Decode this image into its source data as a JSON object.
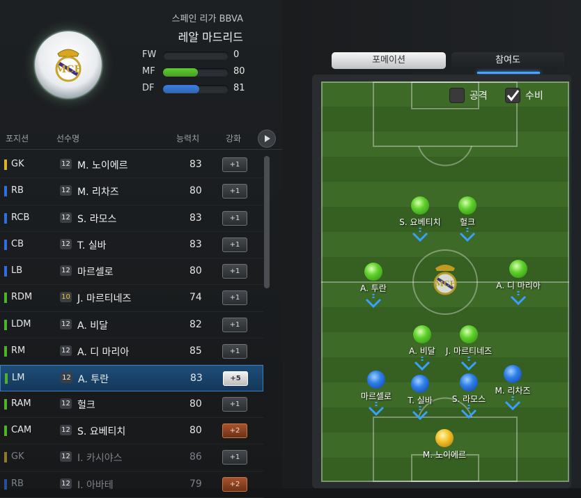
{
  "team": {
    "league": "스페인 리가 BBVA",
    "club": "레알 마드리드",
    "badge_icon": "real-madrid-crest-icon"
  },
  "stats": [
    {
      "label": "FW",
      "value": "0",
      "fill": 0,
      "color": "#2d3236"
    },
    {
      "label": "MF",
      "value": "80",
      "fill": 0.53,
      "color": "#5ccf2a"
    },
    {
      "label": "DF",
      "value": "81",
      "fill": 0.55,
      "color": "#3a7fe6"
    }
  ],
  "columns": {
    "position": "포지션",
    "name": "선수명",
    "rating": "능력치",
    "enhance": "강화"
  },
  "players": [
    {
      "pos": "GK",
      "poscolor": "#d9b42a",
      "card": "12",
      "name": "M. 노이에르",
      "ovr": "83",
      "enh": "+1",
      "style": "",
      "dim": false,
      "sel": false
    },
    {
      "pos": "RB",
      "poscolor": "#2f6fe0",
      "card": "12",
      "name": "M. 리차즈",
      "ovr": "80",
      "enh": "+1",
      "style": "",
      "dim": false,
      "sel": false
    },
    {
      "pos": "RCB",
      "poscolor": "#2f6fe0",
      "card": "12",
      "name": "S. 라모스",
      "ovr": "83",
      "enh": "+1",
      "style": "",
      "dim": false,
      "sel": false
    },
    {
      "pos": "CB",
      "poscolor": "#2f6fe0",
      "card": "12",
      "name": "T. 실바",
      "ovr": "83",
      "enh": "+1",
      "style": "",
      "dim": false,
      "sel": false
    },
    {
      "pos": "LB",
      "poscolor": "#2f6fe0",
      "card": "12",
      "name": "마르셀로",
      "ovr": "80",
      "enh": "+1",
      "style": "",
      "dim": false,
      "sel": false
    },
    {
      "pos": "RDM",
      "poscolor": "#4db32b",
      "card": "10",
      "name": "J. 마르티네즈",
      "ovr": "74",
      "enh": "+1",
      "style": "",
      "dim": false,
      "sel": false,
      "gold": true
    },
    {
      "pos": "LDM",
      "poscolor": "#4db32b",
      "card": "12",
      "name": "A. 비달",
      "ovr": "82",
      "enh": "+1",
      "style": "",
      "dim": false,
      "sel": false
    },
    {
      "pos": "RM",
      "poscolor": "#4db32b",
      "card": "12",
      "name": "A. 디 마리아",
      "ovr": "85",
      "enh": "+1",
      "style": "",
      "dim": false,
      "sel": false
    },
    {
      "pos": "LM",
      "poscolor": "#4db32b",
      "card": "12",
      "name": "A. 투란",
      "ovr": "83",
      "enh": "+5",
      "style": "white",
      "dim": false,
      "sel": true
    },
    {
      "pos": "RAM",
      "poscolor": "#4db32b",
      "card": "12",
      "name": "헐크",
      "ovr": "80",
      "enh": "+1",
      "style": "",
      "dim": false,
      "sel": false
    },
    {
      "pos": "CAM",
      "poscolor": "#4db32b",
      "card": "12",
      "name": "S. 요베티치",
      "ovr": "80",
      "enh": "+2",
      "style": "orange",
      "dim": false,
      "sel": false
    },
    {
      "pos": "GK",
      "poscolor": "#8a7a2a",
      "card": "12",
      "name": "I. 카시야스",
      "ovr": "86",
      "enh": "+1",
      "style": "",
      "dim": true,
      "sel": false
    },
    {
      "pos": "RB",
      "poscolor": "#2a4f99",
      "card": "12",
      "name": "I. 아바테",
      "ovr": "79",
      "enh": "+2",
      "style": "orange",
      "dim": true,
      "sel": false
    }
  ],
  "tabs": {
    "formation": "포메이션",
    "participation": "참여도"
  },
  "filters": {
    "attack": "공격",
    "defense": "수비",
    "attack_checked": false,
    "defense_checked": true
  },
  "pitch_players": [
    {
      "name": "S. 요베티치",
      "color": "g"
    },
    {
      "name": "헐크",
      "color": "g"
    },
    {
      "name": "A. 투란",
      "color": "g"
    },
    {
      "name": "A. 디 마리아",
      "color": "g"
    },
    {
      "name": "A. 비달",
      "color": "g"
    },
    {
      "name": "J. 마르티네즈",
      "color": "g"
    },
    {
      "name": "마르셀로",
      "color": "b"
    },
    {
      "name": "T. 실바",
      "color": "b"
    },
    {
      "name": "S. 라모스",
      "color": "b"
    },
    {
      "name": "M. 리차즈",
      "color": "b"
    },
    {
      "name": "M. 노이에르",
      "color": "y"
    }
  ]
}
